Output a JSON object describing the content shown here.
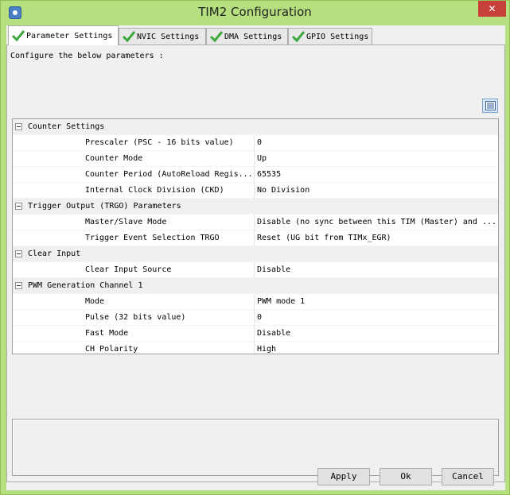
{
  "window": {
    "title": "TIM2 Configuration",
    "close_label": "✕"
  },
  "tabs": [
    {
      "label": "Parameter Settings",
      "active": true
    },
    {
      "label": "NVIC Settings",
      "active": false
    },
    {
      "label": "DMA Settings",
      "active": false
    },
    {
      "label": "GPIO Settings",
      "active": false
    }
  ],
  "intro_text": "Configure the below parameters :",
  "groups": [
    {
      "label": "Counter Settings",
      "props": [
        {
          "name": "Prescaler (PSC - 16 bits value)",
          "value": "0"
        },
        {
          "name": "Counter Mode",
          "value": "Up"
        },
        {
          "name": "Counter Period (AutoReload Regis...",
          "value": "65535"
        },
        {
          "name": "Internal Clock Division (CKD)",
          "value": "No Division"
        }
      ]
    },
    {
      "label": "Trigger Output (TRGO) Parameters",
      "props": [
        {
          "name": "Master/Slave Mode",
          "value": "Disable (no sync between this TIM (Master) and ..."
        },
        {
          "name": "Trigger Event Selection TRGO",
          "value": "Reset (UG bit from TIMx_EGR)"
        }
      ]
    },
    {
      "label": "Clear Input",
      "props": [
        {
          "name": "Clear Input Source",
          "value": "Disable"
        }
      ]
    },
    {
      "label": "PWM Generation Channel 1",
      "props": [
        {
          "name": "Mode",
          "value": "PWM mode 1"
        },
        {
          "name": "Pulse (32 bits value)",
          "value": "0"
        },
        {
          "name": "Fast Mode",
          "value": "Disable"
        },
        {
          "name": "CH Polarity",
          "value": "High"
        }
      ]
    }
  ],
  "buttons": {
    "apply": "Apply",
    "ok": "Ok",
    "cancel": "Cancel"
  },
  "colors": {
    "frame": "#b6e07f",
    "close": "#c7403a",
    "check": "#3da83d"
  }
}
